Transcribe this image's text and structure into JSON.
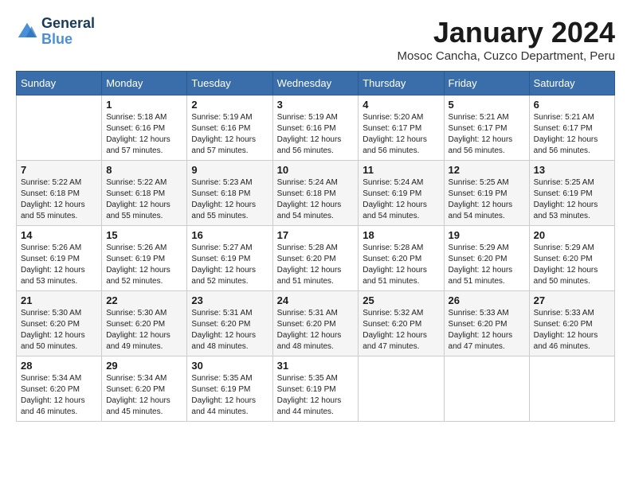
{
  "logo": {
    "line1": "General",
    "line2": "Blue"
  },
  "title": "January 2024",
  "subtitle": "Mosoc Cancha, Cuzco Department, Peru",
  "days_of_week": [
    "Sunday",
    "Monday",
    "Tuesday",
    "Wednesday",
    "Thursday",
    "Friday",
    "Saturday"
  ],
  "weeks": [
    [
      {
        "day": "",
        "info": ""
      },
      {
        "day": "1",
        "info": "Sunrise: 5:18 AM\nSunset: 6:16 PM\nDaylight: 12 hours\nand 57 minutes."
      },
      {
        "day": "2",
        "info": "Sunrise: 5:19 AM\nSunset: 6:16 PM\nDaylight: 12 hours\nand 57 minutes."
      },
      {
        "day": "3",
        "info": "Sunrise: 5:19 AM\nSunset: 6:16 PM\nDaylight: 12 hours\nand 56 minutes."
      },
      {
        "day": "4",
        "info": "Sunrise: 5:20 AM\nSunset: 6:17 PM\nDaylight: 12 hours\nand 56 minutes."
      },
      {
        "day": "5",
        "info": "Sunrise: 5:21 AM\nSunset: 6:17 PM\nDaylight: 12 hours\nand 56 minutes."
      },
      {
        "day": "6",
        "info": "Sunrise: 5:21 AM\nSunset: 6:17 PM\nDaylight: 12 hours\nand 56 minutes."
      }
    ],
    [
      {
        "day": "7",
        "info": "Sunrise: 5:22 AM\nSunset: 6:18 PM\nDaylight: 12 hours\nand 55 minutes."
      },
      {
        "day": "8",
        "info": "Sunrise: 5:22 AM\nSunset: 6:18 PM\nDaylight: 12 hours\nand 55 minutes."
      },
      {
        "day": "9",
        "info": "Sunrise: 5:23 AM\nSunset: 6:18 PM\nDaylight: 12 hours\nand 55 minutes."
      },
      {
        "day": "10",
        "info": "Sunrise: 5:24 AM\nSunset: 6:18 PM\nDaylight: 12 hours\nand 54 minutes."
      },
      {
        "day": "11",
        "info": "Sunrise: 5:24 AM\nSunset: 6:19 PM\nDaylight: 12 hours\nand 54 minutes."
      },
      {
        "day": "12",
        "info": "Sunrise: 5:25 AM\nSunset: 6:19 PM\nDaylight: 12 hours\nand 54 minutes."
      },
      {
        "day": "13",
        "info": "Sunrise: 5:25 AM\nSunset: 6:19 PM\nDaylight: 12 hours\nand 53 minutes."
      }
    ],
    [
      {
        "day": "14",
        "info": "Sunrise: 5:26 AM\nSunset: 6:19 PM\nDaylight: 12 hours\nand 53 minutes."
      },
      {
        "day": "15",
        "info": "Sunrise: 5:26 AM\nSunset: 6:19 PM\nDaylight: 12 hours\nand 52 minutes."
      },
      {
        "day": "16",
        "info": "Sunrise: 5:27 AM\nSunset: 6:19 PM\nDaylight: 12 hours\nand 52 minutes."
      },
      {
        "day": "17",
        "info": "Sunrise: 5:28 AM\nSunset: 6:20 PM\nDaylight: 12 hours\nand 51 minutes."
      },
      {
        "day": "18",
        "info": "Sunrise: 5:28 AM\nSunset: 6:20 PM\nDaylight: 12 hours\nand 51 minutes."
      },
      {
        "day": "19",
        "info": "Sunrise: 5:29 AM\nSunset: 6:20 PM\nDaylight: 12 hours\nand 51 minutes."
      },
      {
        "day": "20",
        "info": "Sunrise: 5:29 AM\nSunset: 6:20 PM\nDaylight: 12 hours\nand 50 minutes."
      }
    ],
    [
      {
        "day": "21",
        "info": "Sunrise: 5:30 AM\nSunset: 6:20 PM\nDaylight: 12 hours\nand 50 minutes."
      },
      {
        "day": "22",
        "info": "Sunrise: 5:30 AM\nSunset: 6:20 PM\nDaylight: 12 hours\nand 49 minutes."
      },
      {
        "day": "23",
        "info": "Sunrise: 5:31 AM\nSunset: 6:20 PM\nDaylight: 12 hours\nand 48 minutes."
      },
      {
        "day": "24",
        "info": "Sunrise: 5:31 AM\nSunset: 6:20 PM\nDaylight: 12 hours\nand 48 minutes."
      },
      {
        "day": "25",
        "info": "Sunrise: 5:32 AM\nSunset: 6:20 PM\nDaylight: 12 hours\nand 47 minutes."
      },
      {
        "day": "26",
        "info": "Sunrise: 5:33 AM\nSunset: 6:20 PM\nDaylight: 12 hours\nand 47 minutes."
      },
      {
        "day": "27",
        "info": "Sunrise: 5:33 AM\nSunset: 6:20 PM\nDaylight: 12 hours\nand 46 minutes."
      }
    ],
    [
      {
        "day": "28",
        "info": "Sunrise: 5:34 AM\nSunset: 6:20 PM\nDaylight: 12 hours\nand 46 minutes."
      },
      {
        "day": "29",
        "info": "Sunrise: 5:34 AM\nSunset: 6:20 PM\nDaylight: 12 hours\nand 45 minutes."
      },
      {
        "day": "30",
        "info": "Sunrise: 5:35 AM\nSunset: 6:19 PM\nDaylight: 12 hours\nand 44 minutes."
      },
      {
        "day": "31",
        "info": "Sunrise: 5:35 AM\nSunset: 6:19 PM\nDaylight: 12 hours\nand 44 minutes."
      },
      {
        "day": "",
        "info": ""
      },
      {
        "day": "",
        "info": ""
      },
      {
        "day": "",
        "info": ""
      }
    ]
  ]
}
